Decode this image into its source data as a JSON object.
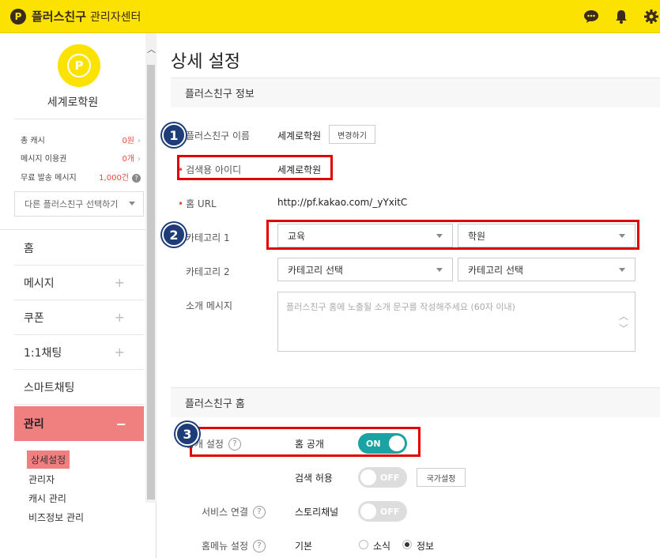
{
  "app": {
    "brand": "플러스친구",
    "subtitle": "관리자센터",
    "logo_letter": "P"
  },
  "topbar_icons": [
    "chat-icon",
    "bell-icon",
    "gear-icon"
  ],
  "sidebar": {
    "profile_name": "세계로학원",
    "stats": [
      {
        "label": "총 캐시",
        "value": "0원"
      },
      {
        "label": "메시지 이용권",
        "value": "0개"
      },
      {
        "label": "무료 발송 메시지",
        "value": "1,000건"
      }
    ],
    "select_placeholder": "다른 플러스친구 선택하기",
    "nav": [
      {
        "label": "홈",
        "expand": ""
      },
      {
        "label": "메시지",
        "expand": "+"
      },
      {
        "label": "쿠폰",
        "expand": "+"
      },
      {
        "label": "1:1채팅",
        "expand": "+"
      },
      {
        "label": "스마트채팅",
        "expand": ""
      },
      {
        "label": "관리",
        "expand": "−"
      }
    ],
    "sub_nav": [
      "상세설정",
      "관리자",
      "캐시 관리",
      "비즈정보 관리"
    ]
  },
  "main": {
    "title": "상세 설정",
    "section1": "플러스친구 정보",
    "rows": {
      "name_label": "플러스친구 이름",
      "name_value": "세계로학원",
      "change_button": "변경하기",
      "search_id_label": "검색용 아이디",
      "search_id_value": "세계로학원",
      "home_url_label": "홈 URL",
      "home_url_value": "http://pf.kakao.com/_yYxitC",
      "category1_label": "카테고리 1",
      "category1_a": "교육",
      "category1_b": "학원",
      "category2_label": "카테고리 2",
      "category2_a": "카테고리 선택",
      "category2_b": "카테고리 선택",
      "intro_label": "소개 메시지",
      "intro_placeholder": "플러스친구 홈에 노출될 소개 문구를 작성해주세요 (60자 이내)"
    },
    "section2": "플러스친구 홈",
    "home": {
      "public_label": "공개 설정",
      "home_public": "홈 공개",
      "on_text": "ON",
      "search_allow": "검색 허용",
      "off_text": "OFF",
      "country_button": "국가설정",
      "service_label": "서비스 연결",
      "story_channel": "스토리채널",
      "menu_label": "홈메뉴 설정",
      "menu_default": "기본",
      "radio_news": "소식",
      "radio_info": "정보"
    },
    "help_glyph": "?"
  },
  "annotations": [
    "1",
    "2",
    "3"
  ],
  "colors": {
    "brand_yellow": "#fce200",
    "active_nav": "#f08080",
    "toggle_on": "#1aa3a3",
    "annotation_red": "#e00000",
    "badge_blue": "#1e3c78"
  }
}
